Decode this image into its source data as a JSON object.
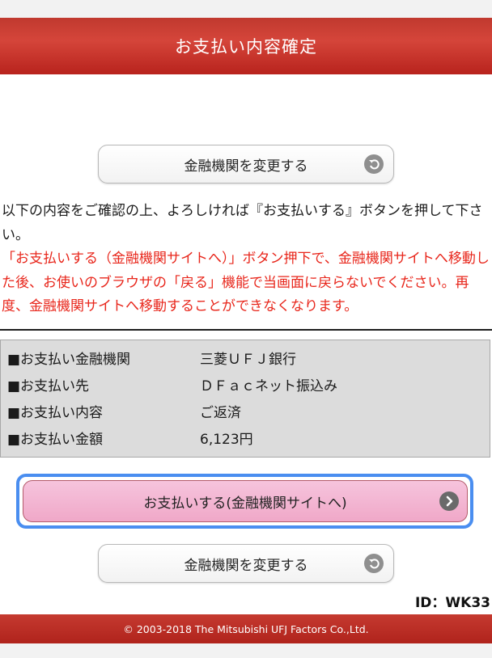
{
  "header": {
    "title": "お支払い内容確定"
  },
  "buttons": {
    "change_bank_label": "金融機関を変更する",
    "pay_label": "お支払いする(金融機関サイトへ)"
  },
  "message": {
    "instruction": "以下の内容をご確認の上、よろしければ『お支払いする』ボタンを押して下さい。",
    "warning": "「お支払いする（金融機関サイトへ）」ボタン押下で、金融機関サイトへ移動した後、お使いのブラウザの「戻る」機能で当画面に戻らないでください。再度、金融機関サイトへ移動することができなくなります。"
  },
  "details": [
    {
      "label": "■お支払い金融機関",
      "value": "三菱ＵＦＪ銀行"
    },
    {
      "label": "■お支払い先",
      "value": "ＤＦａｃネット振込み"
    },
    {
      "label": "■お支払い内容",
      "value": "ご返済"
    },
    {
      "label": "■お支払い金額",
      "value": "6,123円"
    }
  ],
  "screen_id": "ID：WK33",
  "footer": {
    "copyright": "© 2003-2018 The Mitsubishi UFJ Factors Co.,Ltd."
  },
  "colors": {
    "header_red": "#c0392f",
    "warning_red": "#e8261b",
    "pay_pink": "#f0a8c8",
    "focus_blue": "#4a8ef0"
  },
  "icons": {
    "change_button_icon": "back-arrow-circle-icon",
    "pay_button_icon": "chevron-right-circle-icon"
  }
}
